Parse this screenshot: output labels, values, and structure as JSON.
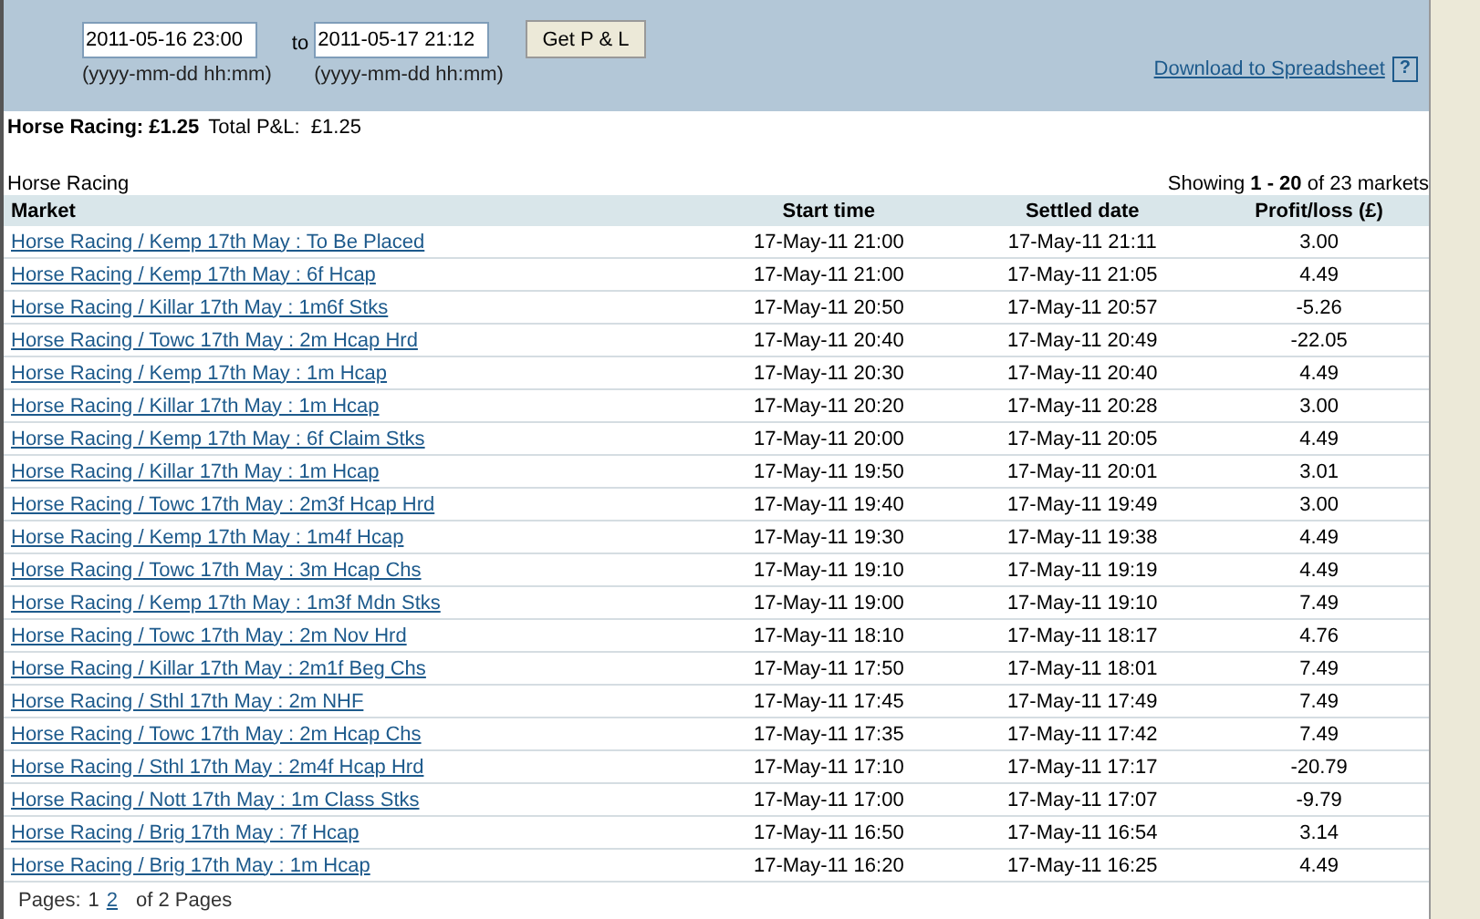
{
  "filter": {
    "from": {
      "value": "2011-05-16 23:00",
      "hint": "(yyyy-mm-dd hh:mm)"
    },
    "separator": "to",
    "to": {
      "value": "2011-05-17 21:12",
      "hint": "(yyyy-mm-dd hh:mm)"
    },
    "button": "Get P & L",
    "download_link": "Download to Spreadsheet",
    "help": "?"
  },
  "summary": {
    "bold": "Horse Racing: £1.25",
    "total": "Total P&L:  £1.25"
  },
  "table": {
    "caption": "Horse Racing",
    "showing": "Showing **1 - 20** of 23 markets",
    "columns": [
      "Market",
      "Start time",
      "Settled date",
      "Profit/loss (£)"
    ],
    "rows": [
      [
        "Horse Racing / Kemp 17th May : To Be Placed",
        "17-May-11 21:00",
        "17-May-11 21:11",
        "3.00"
      ],
      [
        "Horse Racing / Kemp 17th May : 6f Hcap",
        "17-May-11 21:00",
        "17-May-11 21:05",
        "4.49"
      ],
      [
        "Horse Racing / Killar 17th May : 1m6f Stks",
        "17-May-11 20:50",
        "17-May-11 20:57",
        "-5.26"
      ],
      [
        "Horse Racing / Towc 17th May : 2m Hcap Hrd",
        "17-May-11 20:40",
        "17-May-11 20:49",
        "-22.05"
      ],
      [
        "Horse Racing / Kemp 17th May : 1m Hcap",
        "17-May-11 20:30",
        "17-May-11 20:40",
        "4.49"
      ],
      [
        "Horse Racing / Killar 17th May : 1m Hcap",
        "17-May-11 20:20",
        "17-May-11 20:28",
        "3.00"
      ],
      [
        "Horse Racing / Kemp 17th May : 6f Claim Stks",
        "17-May-11 20:00",
        "17-May-11 20:05",
        "4.49"
      ],
      [
        "Horse Racing / Killar 17th May : 1m Hcap",
        "17-May-11 19:50",
        "17-May-11 20:01",
        "3.01"
      ],
      [
        "Horse Racing / Towc 17th May : 2m3f Hcap Hrd",
        "17-May-11 19:40",
        "17-May-11 19:49",
        "3.00"
      ],
      [
        "Horse Racing / Kemp 17th May : 1m4f Hcap",
        "17-May-11 19:30",
        "17-May-11 19:38",
        "4.49"
      ],
      [
        "Horse Racing / Towc 17th May : 3m Hcap Chs",
        "17-May-11 19:10",
        "17-May-11 19:19",
        "4.49"
      ],
      [
        "Horse Racing / Kemp 17th May : 1m3f Mdn Stks",
        "17-May-11 19:00",
        "17-May-11 19:10",
        "7.49"
      ],
      [
        "Horse Racing / Towc 17th May : 2m Nov Hrd",
        "17-May-11 18:10",
        "17-May-11 18:17",
        "4.76"
      ],
      [
        "Horse Racing / Killar 17th May : 2m1f Beg Chs",
        "17-May-11 17:50",
        "17-May-11 18:01",
        "7.49"
      ],
      [
        "Horse Racing / Sthl 17th May : 2m NHF",
        "17-May-11 17:45",
        "17-May-11 17:49",
        "7.49"
      ],
      [
        "Horse Racing / Towc 17th May : 2m Hcap Chs",
        "17-May-11 17:35",
        "17-May-11 17:42",
        "7.49"
      ],
      [
        "Horse Racing / Sthl 17th May : 2m4f Hcap Hrd",
        "17-May-11 17:10",
        "17-May-11 17:17",
        "-20.79"
      ],
      [
        "Horse Racing / Nott 17th May : 1m Class Stks",
        "17-May-11 17:00",
        "17-May-11 17:07",
        "-9.79"
      ],
      [
        "Horse Racing / Brig 17th May : 7f Hcap",
        "17-May-11 16:50",
        "17-May-11 16:54",
        "3.14"
      ],
      [
        "Horse Racing / Brig 17th May : 1m Hcap",
        "17-May-11 16:20",
        "17-May-11 16:25",
        "4.49"
      ]
    ]
  },
  "pager": {
    "label": "Pages:",
    "pages": [
      {
        "label": "1",
        "selected": true
      },
      {
        "label": "2",
        "selected": false
      }
    ],
    "total": "of 2 Pages"
  }
}
